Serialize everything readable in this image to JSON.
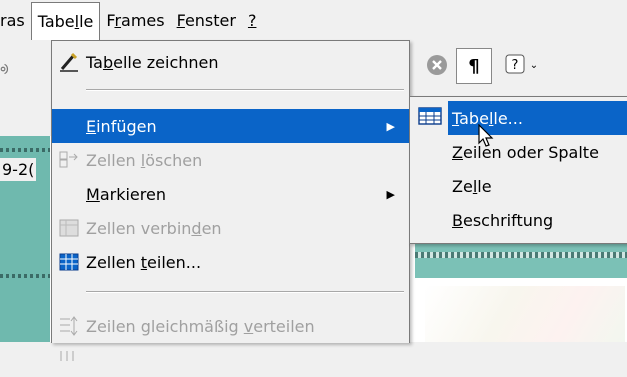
{
  "menubar": {
    "items": [
      {
        "label": "ras"
      },
      {
        "label": "Tabelle",
        "active": true
      },
      {
        "label": "Frames"
      },
      {
        "label": "Fenster"
      },
      {
        "label": "?"
      }
    ]
  },
  "left_doc": {
    "label": "9-2("
  },
  "tabelle_menu": {
    "items": [
      {
        "label": "Tabelle zeichnen",
        "icon": "pencil-icon",
        "enabled": true
      },
      {
        "label": "Einfügen",
        "icon": "",
        "enabled": true,
        "highlighted": true,
        "has_submenu": true
      },
      {
        "label": "Zellen löschen",
        "icon": "delete-cells-icon",
        "enabled": false
      },
      {
        "label": "Markieren",
        "icon": "",
        "enabled": true,
        "has_submenu": true
      },
      {
        "label": "Zellen verbinden",
        "icon": "merge-cells-icon",
        "enabled": false
      },
      {
        "label": "Zellen teilen...",
        "icon": "split-cells-icon",
        "enabled": true
      },
      {
        "label": "Zeilen gleichmäßig verteilen",
        "icon": "distribute-rows-icon",
        "enabled": false
      }
    ]
  },
  "einfuegen_submenu": {
    "items": [
      {
        "label": "Tabelle...",
        "icon": "table-icon",
        "highlighted": true
      },
      {
        "label": "Zeilen oder Spalte"
      },
      {
        "label": "Zelle"
      },
      {
        "label": "Beschriftung"
      }
    ]
  },
  "toolbar": {
    "pilcrow": "¶",
    "help": "?"
  },
  "colors": {
    "highlight": "#0a64c8",
    "menu_bg": "#f0f0f0",
    "teal": "#6fb9ae",
    "disabled_text": "#a0a0a0"
  }
}
